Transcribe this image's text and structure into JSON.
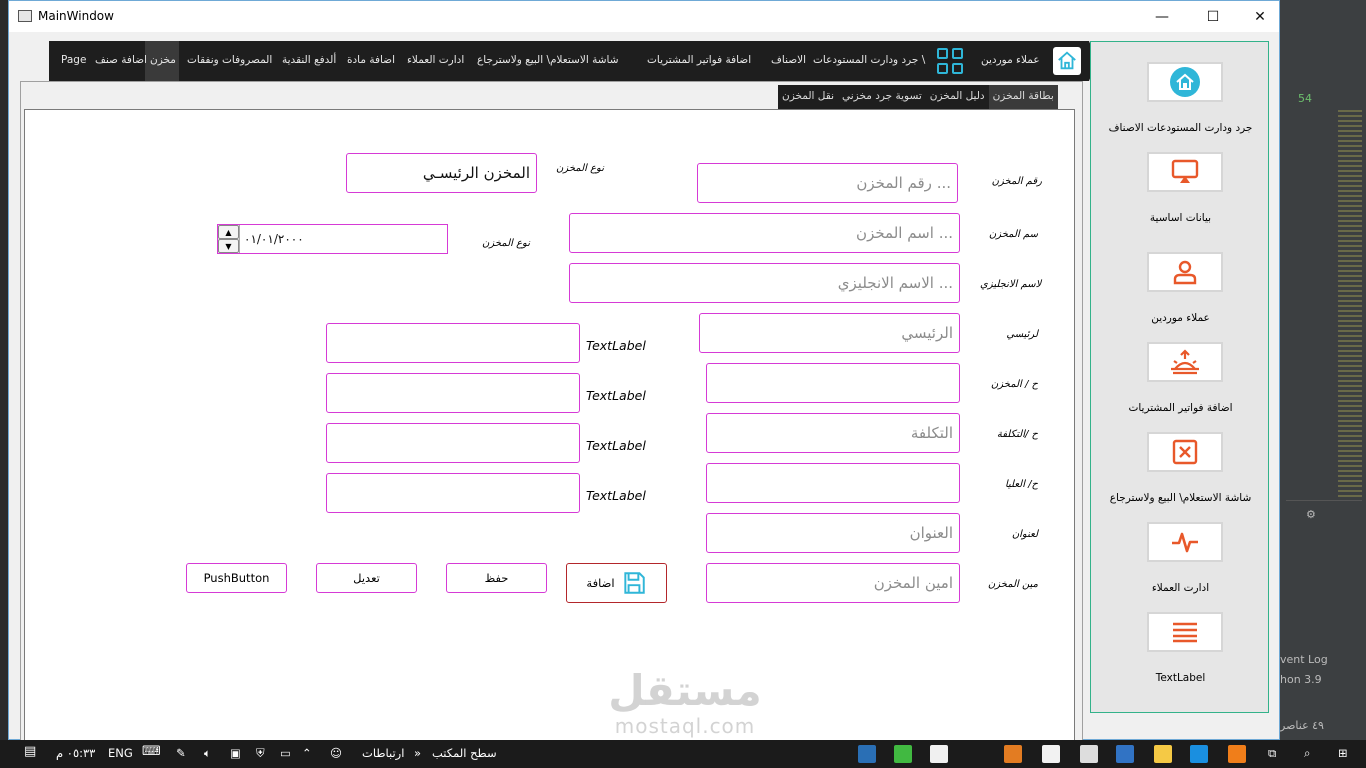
{
  "window": {
    "title": "MainWindow",
    "minimize": "—",
    "maximize": "☐",
    "close": "✕"
  },
  "topnav": {
    "items": [
      "Page",
      "اضافة صنف",
      "مخزن",
      "المصروفات ونفقات",
      "ألدفع النقدية",
      "اضافة مادة",
      "ادارت العملاء",
      "شاشة الاستعلام\\ البيع ولاسترجاع",
      "اضافة فواتير المشتريات",
      "الاصناف",
      "جرد ودارت المستودعات \\",
      "عملاء موردين"
    ]
  },
  "tabs": [
    "بطاقة المخزن",
    "دليل المخزن",
    "تسوية جرد مخزني",
    "نقل المخزن"
  ],
  "form": {
    "store_number_label": "رقم المخزن",
    "store_number_placeholder": "رقم المخزن ...",
    "store_type_label": "نوع المخزن",
    "store_type_value": "المخزن الرئيسـي",
    "store_name_label": "سم المخزن",
    "store_name_placeholder": "اسم المخزن ...",
    "date_label": "نوع المخزن",
    "date_value": "٠١/٠١/٢٠٠٠",
    "english_name_label": "لاسم الانجليزي",
    "english_name_placeholder": "الاسم الانجليزي ...",
    "main_label": "لرئيسي",
    "main_placeholder": "الرئيسي",
    "store_account_label": "ح / المخزن",
    "cost_account_label": "ح /التكلفة",
    "cost_placeholder": "التكلفة",
    "upper_account_label": "ح/ العليا",
    "address_label": "لعنوان",
    "address_placeholder": "العنوان",
    "keeper_label": "مين المخزن",
    "keeper_placeholder": "امين المخزن",
    "text_label": "TextLabel"
  },
  "buttons": {
    "add": "اضافة",
    "save": "حفظ",
    "edit": "تعديل",
    "push": "PushButton"
  },
  "sidebar": {
    "items": [
      {
        "label": "جرد ودارت المستودعات    الاصناف",
        "icon": "house-icon"
      },
      {
        "label": "بيانات اساسية",
        "icon": "monitor-icon"
      },
      {
        "label": "عملاء موردين",
        "icon": "user-icon"
      },
      {
        "label": "اضافة فواتير المشتريات",
        "icon": "sunrise-icon"
      },
      {
        "label": "شاشة الاستعلام\\ البيع ولاسترجاع",
        "icon": "close-box-icon"
      },
      {
        "label": "ادارت العملاء",
        "icon": "pulse-icon"
      },
      {
        "label": "TextLabel",
        "icon": "menu-icon"
      }
    ]
  },
  "watermark": {
    "arabic": "مستقل",
    "latin": "mostaql.com"
  },
  "ide": {
    "count": "54",
    "event_log": "vent Log",
    "python": "hon 3.9",
    "items": "٤٩ عناصر"
  },
  "taskbar": {
    "time": "٠٥:٣٣ م",
    "lang": "ENG",
    "links": "ارتباطات",
    "desktop": "سطح المكتب"
  },
  "colors": {
    "accent": "#d63ad6",
    "icon_orange": "#e8582a",
    "icon_cyan": "#2fb6d8",
    "sidebar_border": "#33b28a"
  }
}
